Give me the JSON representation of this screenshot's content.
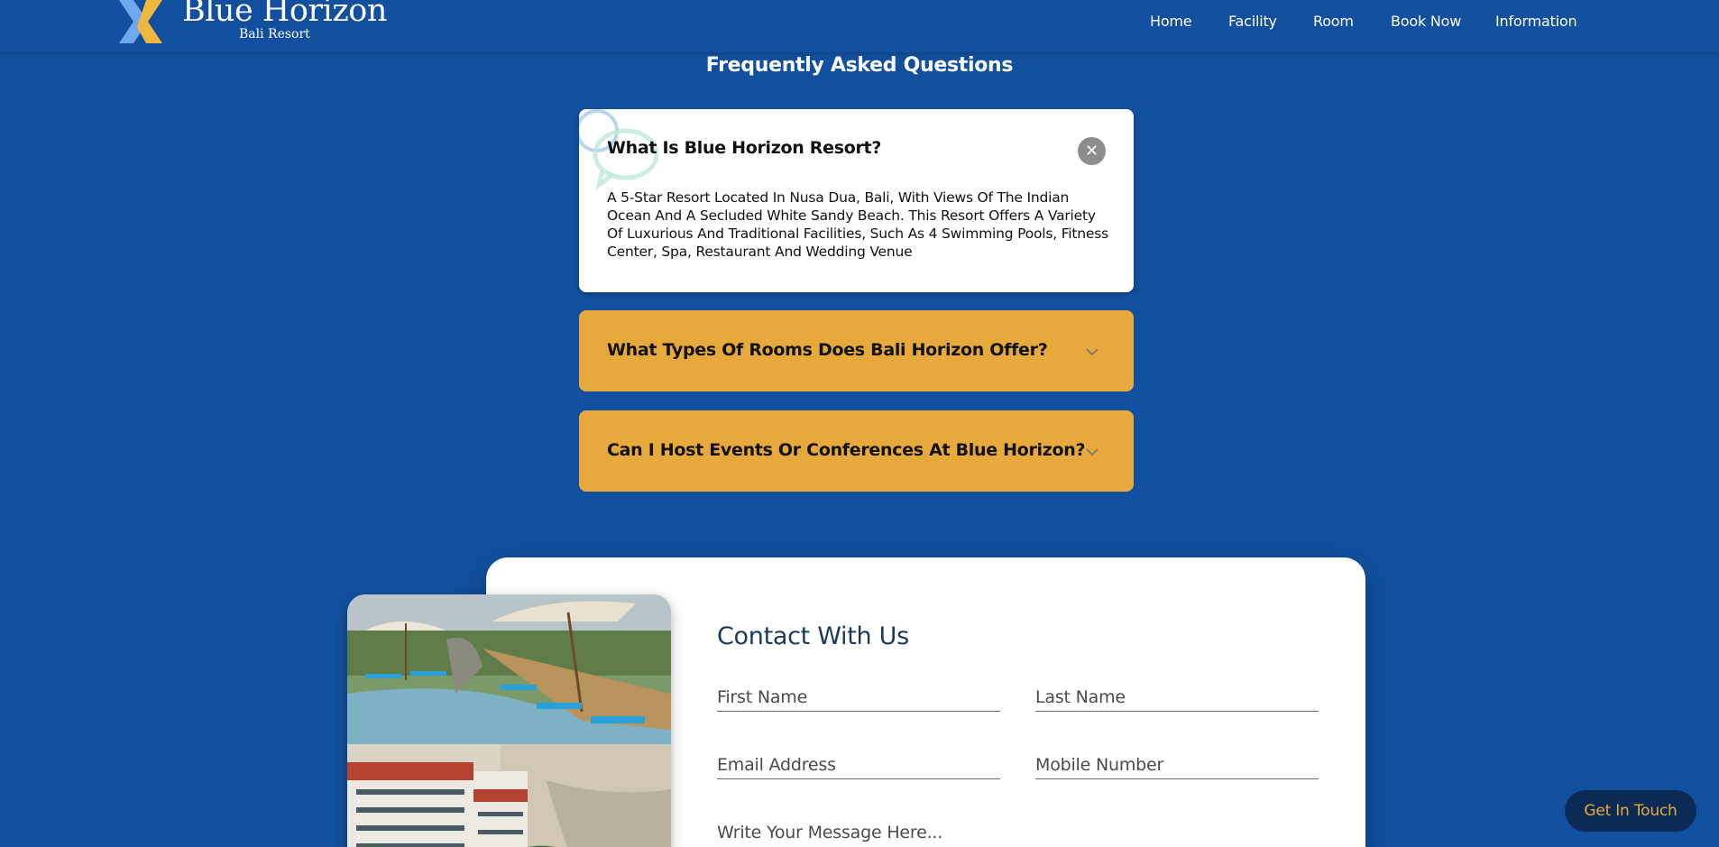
{
  "header": {
    "brand_title": "Blue Horizon",
    "brand_subtitle": "Bali Resort",
    "nav": [
      "Home",
      "Facility",
      "Room",
      "Book Now",
      "Information"
    ]
  },
  "faq": {
    "title": "Frequently Asked Questions",
    "items": [
      {
        "question": "What Is Blue Horizon Resort?",
        "answer": "A 5-Star Resort Located In Nusa Dua, Bali, With Views Of The Indian Ocean And A Secluded White Sandy Beach. This Resort Offers A Variety Of Luxurious And Traditional Facilities, Such As 4 Swimming Pools, Fitness Center, Spa, Restaurant And Wedding Venue",
        "expanded": true
      },
      {
        "question": "What Types Of Rooms Does Bali Horizon Offer?",
        "expanded": false
      },
      {
        "question": "Can I Host Events Or Conferences At Blue Horizon?",
        "expanded": false
      }
    ]
  },
  "contact": {
    "title": "Contact With Us",
    "first_name_placeholder": "First Name",
    "last_name_placeholder": "Last Name",
    "email_placeholder": "Email Address",
    "mobile_placeholder": "Mobile Number",
    "message_placeholder": "Write Your Message Here..."
  },
  "cta": {
    "get_in_touch": "Get In Touch"
  },
  "colors": {
    "background": "#11509f",
    "accent": "#e8a93c",
    "cta_bg": "#0b2a55"
  }
}
